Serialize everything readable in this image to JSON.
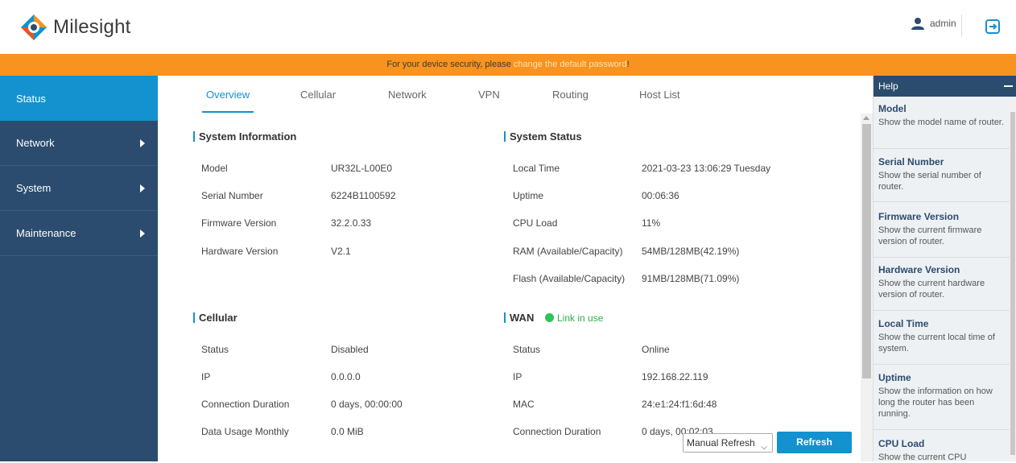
{
  "header": {
    "logo_text": "Milesight",
    "username": "admin"
  },
  "banner": {
    "prefix": "For your device security, please ",
    "link": "change the default password",
    "suffix": "!"
  },
  "sidebar": {
    "items": [
      {
        "label": "Status"
      },
      {
        "label": "Network"
      },
      {
        "label": "System"
      },
      {
        "label": "Maintenance"
      }
    ]
  },
  "tabs": [
    {
      "label": "Overview"
    },
    {
      "label": "Cellular"
    },
    {
      "label": "Network"
    },
    {
      "label": "VPN"
    },
    {
      "label": "Routing"
    },
    {
      "label": "Host List"
    }
  ],
  "system_information": {
    "title": "System Information",
    "rows": [
      {
        "label": "Model",
        "value": "UR32L-L00E0"
      },
      {
        "label": "Serial Number",
        "value": "6224B1100592"
      },
      {
        "label": "Firmware Version",
        "value": "32.2.0.33"
      },
      {
        "label": "Hardware Version",
        "value": "V2.1"
      }
    ]
  },
  "system_status": {
    "title": "System Status",
    "rows": [
      {
        "label": "Local Time",
        "value": "2021-03-23 13:06:29 Tuesday"
      },
      {
        "label": "Uptime",
        "value": "00:06:36"
      },
      {
        "label": "CPU Load",
        "value": "11%"
      },
      {
        "label": "RAM (Available/Capacity)",
        "value": "54MB/128MB(42.19%)"
      },
      {
        "label": "Flash (Available/Capacity)",
        "value": "91MB/128MB(71.09%)"
      }
    ]
  },
  "cellular": {
    "title": "Cellular",
    "rows": [
      {
        "label": "Status",
        "value": "Disabled"
      },
      {
        "label": "IP",
        "value": "0.0.0.0"
      },
      {
        "label": "Connection Duration",
        "value": "0 days, 00:00:00"
      },
      {
        "label": "Data Usage Monthly",
        "value": "0.0 MiB"
      }
    ]
  },
  "wan": {
    "title": "WAN",
    "link_status": "Link in use",
    "rows": [
      {
        "label": "Status",
        "value": "Online"
      },
      {
        "label": "IP",
        "value": "192.168.22.119"
      },
      {
        "label": "MAC",
        "value": "24:e1:24:f1:6d:48"
      },
      {
        "label": "Connection Duration",
        "value": "0 days, 00:02:03"
      }
    ]
  },
  "refresh": {
    "select_value": "Manual Refresh",
    "button_label": "Refresh"
  },
  "help": {
    "title": "Help",
    "items": [
      {
        "title": "Model",
        "desc": "Show the model name of router."
      },
      {
        "title": "Serial Number",
        "desc": "Show the serial number of router."
      },
      {
        "title": "Firmware Version",
        "desc": "Show the current firmware version of router."
      },
      {
        "title": "Hardware Version",
        "desc": "Show the current hardware version of router."
      },
      {
        "title": "Local Time",
        "desc": "Show the current local time of system."
      },
      {
        "title": "Uptime",
        "desc": "Show the information on how long the router has been running."
      },
      {
        "title": "CPU Load",
        "desc": "Show the current CPU"
      }
    ]
  },
  "colors": {
    "accent": "#1491cf",
    "sidebar": "#2b4c6e",
    "banner": "#f7931e",
    "link_green": "#2ec45a"
  }
}
